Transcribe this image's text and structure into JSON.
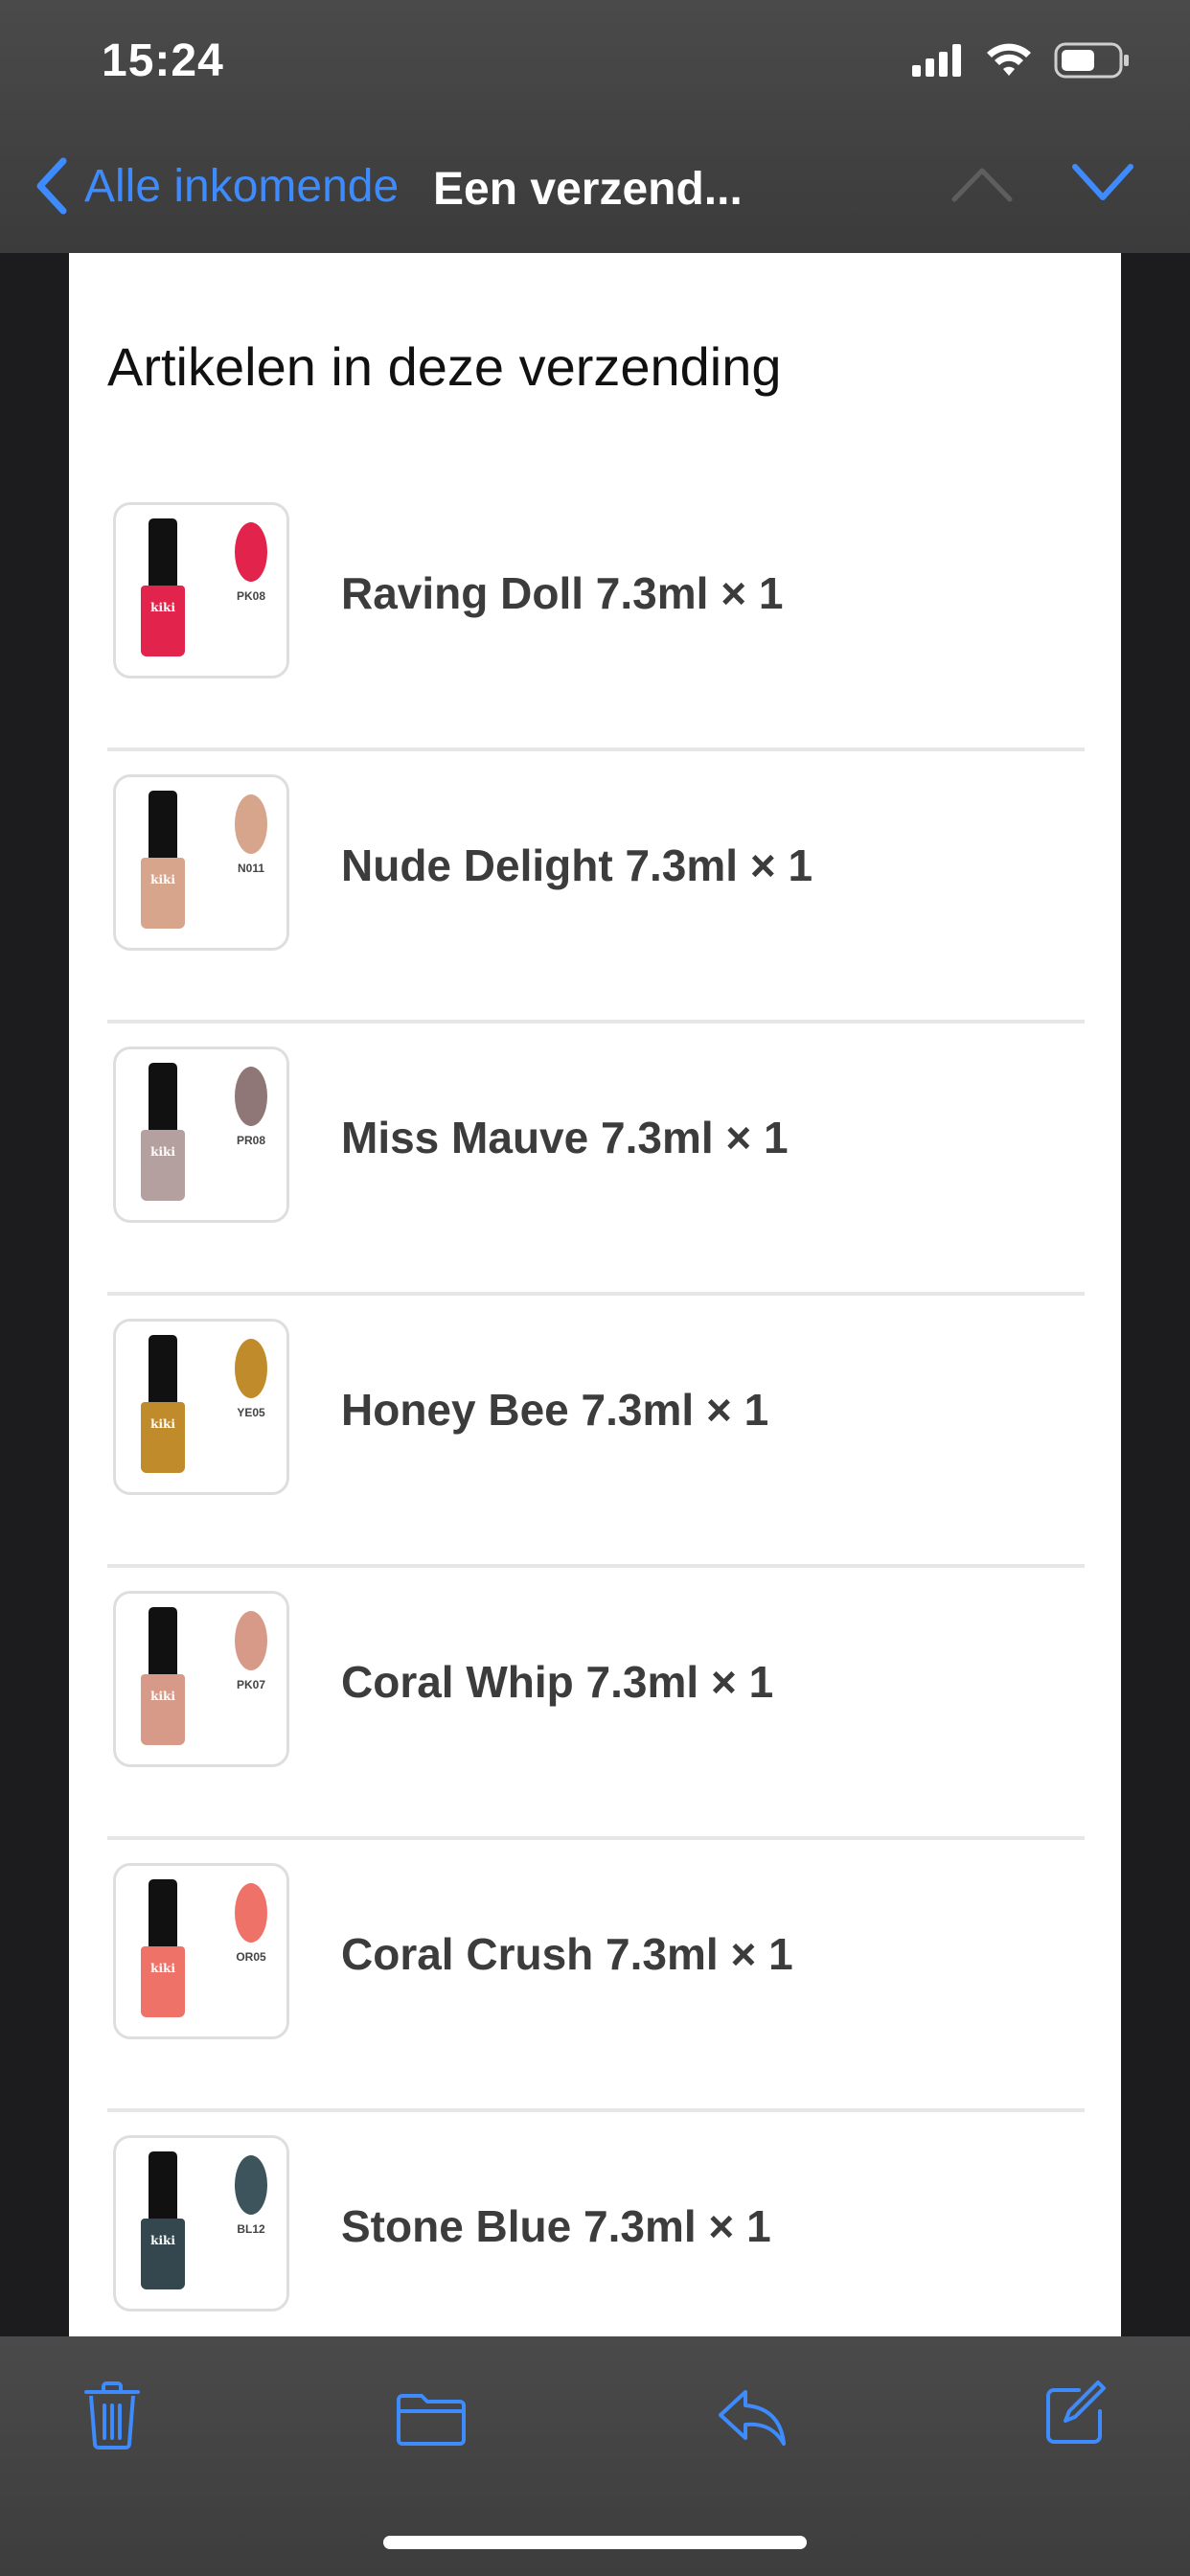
{
  "status_bar": {
    "time": "15:24"
  },
  "nav": {
    "back_label": "Alle inkomende",
    "title": "Een verzend..."
  },
  "content": {
    "heading": "Artikelen in deze verzending",
    "items": [
      {
        "label": "Raving Doll 7.3ml × 1",
        "code": "PK08",
        "color": "#e2234c"
      },
      {
        "label": "Nude Delight 7.3ml × 1",
        "code": "N011",
        "color": "#d7a48c"
      },
      {
        "label": "Miss Mauve 7.3ml × 1",
        "code": "PR08",
        "color": "#a2898a"
      },
      {
        "label": "Honey Bee 7.3ml × 1",
        "code": "YE05",
        "color": "#c08b2a"
      },
      {
        "label": "Coral Whip 7.3ml × 1",
        "code": "PK07",
        "color": "#d89a88"
      },
      {
        "label": "Coral Crush 7.3ml × 1",
        "code": "OR05",
        "color": "#ef7268"
      },
      {
        "label": "Stone Blue 7.3ml × 1",
        "code": "BL12",
        "color": "#34474e"
      }
    ]
  },
  "icons": {
    "back": "chevron-left-icon",
    "up": "chevron-up-icon",
    "down": "chevron-down-icon",
    "trash": "trash-icon",
    "folder": "folder-icon",
    "reply": "reply-icon",
    "compose": "compose-icon"
  },
  "colors": {
    "accent": "#3d8bfd",
    "bar_bg": "#444444",
    "page_bg": "#ffffff"
  }
}
